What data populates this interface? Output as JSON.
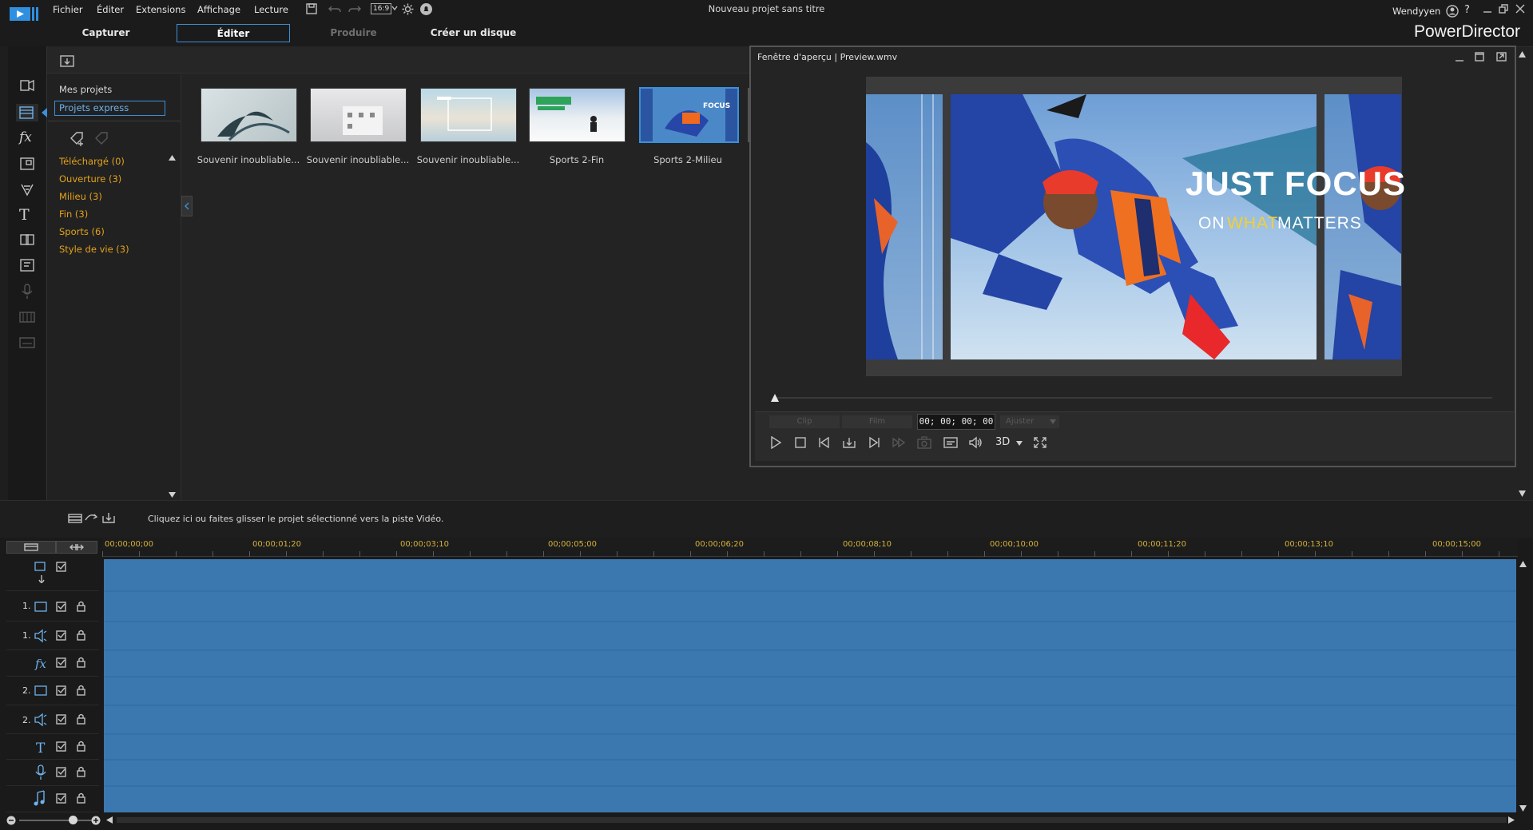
{
  "menu": {
    "items": [
      "Fichier",
      "Éditer",
      "Extensions",
      "Affichage",
      "Lecture"
    ],
    "aspect": "16:9"
  },
  "window": {
    "title": "Nouveau projet sans titre",
    "user": "Wendyyen",
    "help": "?",
    "app_name": "PowerDirector"
  },
  "tabs": [
    "Capturer",
    "Éditer",
    "Produire",
    "Créer un disque"
  ],
  "library": {
    "my_projects": "Mes projets",
    "express_projects": "Projets express",
    "categories": [
      "Téléchargé  (0)",
      "Ouverture  (3)",
      "Milieu  (3)",
      "Fin  (3)",
      "Sports  (6)",
      "Style de vie  (3)"
    ],
    "thumbnails": [
      "Souvenir inoubliable...",
      "Souvenir inoubliable...",
      "Souvenir inoubliable...",
      "Sports 2-Fin",
      "Sports 2-Milieu"
    ]
  },
  "preview": {
    "title": "Fenêtre d'aperçu | Preview.wmv",
    "overlay_line1": "JUST FOCUS",
    "overlay_line2_a": "ON",
    "overlay_line2_b": "WHAT",
    "overlay_line2_c": "MATTERS",
    "mode_clip": "Clip",
    "mode_film": "Film",
    "timecode": "00; 00; 00; 00",
    "fit": "Ajuster",
    "three_d": "3D"
  },
  "timeline": {
    "hint": "Cliquez ici ou faites glisser le projet sélectionné vers la piste Vidéo.",
    "ruler": [
      "00;00;00;00",
      "00;00;01;20",
      "00;00;03;10",
      "00;00;05;00",
      "00;00;06;20",
      "00;00;08;10",
      "00;00;10;00",
      "00;00;11;20",
      "00;00;13;10",
      "00;00;15;00"
    ],
    "track_labels": [
      "",
      "1.",
      "1.",
      "",
      "2.",
      "2.",
      "",
      "",
      ""
    ]
  },
  "colors": {
    "accent": "#e3a21a",
    "track": "#3c7ab3",
    "selected_tab": "#3c8fd8"
  }
}
